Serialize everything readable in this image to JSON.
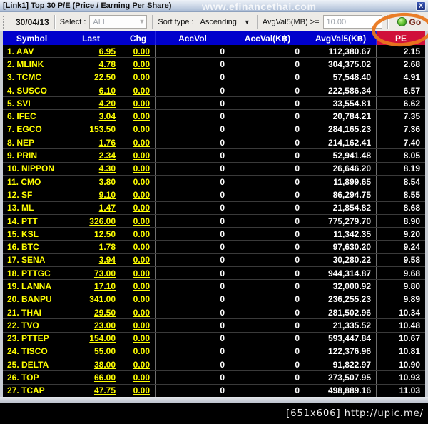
{
  "window": {
    "title": "[Link1] Top 30 P/E (Price / Earning Per Share)",
    "watermark": "www.efinancethai.com",
    "close_label": "X"
  },
  "toolbar": {
    "date": "30/04/13",
    "select_label": "Select :",
    "select_value": "ALL",
    "sort_label": "Sort type :",
    "sort_value": "Ascending",
    "filter_label": "AvgVal5(MB) >=",
    "filter_value": "10.00",
    "go_label": "Go"
  },
  "table": {
    "columns": [
      "Symbol",
      "Last",
      "Chg",
      "AccVol",
      "AccVal(K฿)",
      "AvgVal5(K฿)",
      "PE"
    ],
    "rows": [
      {
        "symbol": "1. AAV",
        "last": "6.95",
        "chg": "0.00",
        "accvol": "0",
        "accval": "0",
        "avgval5": "112,380.67",
        "pe": "2.15"
      },
      {
        "symbol": "2. MLINK",
        "last": "4.78",
        "chg": "0.00",
        "accvol": "0",
        "accval": "0",
        "avgval5": "304,375.02",
        "pe": "2.68"
      },
      {
        "symbol": "3. TCMC",
        "last": "22.50",
        "chg": "0.00",
        "accvol": "0",
        "accval": "0",
        "avgval5": "57,548.40",
        "pe": "4.91"
      },
      {
        "symbol": "4. SUSCO",
        "last": "6.10",
        "chg": "0.00",
        "accvol": "0",
        "accval": "0",
        "avgval5": "222,586.34",
        "pe": "6.57"
      },
      {
        "symbol": "5. SVI",
        "last": "4.20",
        "chg": "0.00",
        "accvol": "0",
        "accval": "0",
        "avgval5": "33,554.81",
        "pe": "6.62"
      },
      {
        "symbol": "6. IFEC",
        "last": "3.04",
        "chg": "0.00",
        "accvol": "0",
        "accval": "0",
        "avgval5": "20,784.21",
        "pe": "7.35"
      },
      {
        "symbol": "7. EGCO",
        "last": "153.50",
        "chg": "0.00",
        "accvol": "0",
        "accval": "0",
        "avgval5": "284,165.23",
        "pe": "7.36"
      },
      {
        "symbol": "8. NEP",
        "last": "1.76",
        "chg": "0.00",
        "accvol": "0",
        "accval": "0",
        "avgval5": "214,162.41",
        "pe": "7.40"
      },
      {
        "symbol": "9. PRIN",
        "last": "2.34",
        "chg": "0.00",
        "accvol": "0",
        "accval": "0",
        "avgval5": "52,941.48",
        "pe": "8.05"
      },
      {
        "symbol": "10. NIPPON",
        "last": "4.30",
        "chg": "0.00",
        "accvol": "0",
        "accval": "0",
        "avgval5": "26,646.20",
        "pe": "8.19"
      },
      {
        "symbol": "11. CMO",
        "last": "3.80",
        "chg": "0.00",
        "accvol": "0",
        "accval": "0",
        "avgval5": "11,899.65",
        "pe": "8.54"
      },
      {
        "symbol": "12. SF",
        "last": "9.10",
        "chg": "0.00",
        "accvol": "0",
        "accval": "0",
        "avgval5": "86,294.75",
        "pe": "8.55"
      },
      {
        "symbol": "13. ML",
        "last": "1.47",
        "chg": "0.00",
        "accvol": "0",
        "accval": "0",
        "avgval5": "21,854.82",
        "pe": "8.68"
      },
      {
        "symbol": "14. PTT",
        "last": "326.00",
        "chg": "0.00",
        "accvol": "0",
        "accval": "0",
        "avgval5": "775,279.70",
        "pe": "8.90"
      },
      {
        "symbol": "15. KSL",
        "last": "12.50",
        "chg": "0.00",
        "accvol": "0",
        "accval": "0",
        "avgval5": "11,342.35",
        "pe": "9.20"
      },
      {
        "symbol": "16. BTC",
        "last": "1.78",
        "chg": "0.00",
        "accvol": "0",
        "accval": "0",
        "avgval5": "97,630.20",
        "pe": "9.24"
      },
      {
        "symbol": "17. SENA",
        "last": "3.94",
        "chg": "0.00",
        "accvol": "0",
        "accval": "0",
        "avgval5": "30,280.22",
        "pe": "9.58"
      },
      {
        "symbol": "18. PTTGC",
        "last": "73.00",
        "chg": "0.00",
        "accvol": "0",
        "accval": "0",
        "avgval5": "944,314.87",
        "pe": "9.68"
      },
      {
        "symbol": "19. LANNA",
        "last": "17.10",
        "chg": "0.00",
        "accvol": "0",
        "accval": "0",
        "avgval5": "32,000.92",
        "pe": "9.80"
      },
      {
        "symbol": "20. BANPU",
        "last": "341.00",
        "chg": "0.00",
        "accvol": "0",
        "accval": "0",
        "avgval5": "236,255.23",
        "pe": "9.89"
      },
      {
        "symbol": "21. THAI",
        "last": "29.50",
        "chg": "0.00",
        "accvol": "0",
        "accval": "0",
        "avgval5": "281,502.96",
        "pe": "10.34"
      },
      {
        "symbol": "22. TVO",
        "last": "23.00",
        "chg": "0.00",
        "accvol": "0",
        "accval": "0",
        "avgval5": "21,335.52",
        "pe": "10.48"
      },
      {
        "symbol": "23. PTTEP",
        "last": "154.00",
        "chg": "0.00",
        "accvol": "0",
        "accval": "0",
        "avgval5": "593,447.84",
        "pe": "10.67"
      },
      {
        "symbol": "24. TISCO",
        "last": "55.00",
        "chg": "0.00",
        "accvol": "0",
        "accval": "0",
        "avgval5": "122,376.96",
        "pe": "10.81"
      },
      {
        "symbol": "25. DELTA",
        "last": "38.00",
        "chg": "0.00",
        "accvol": "0",
        "accval": "0",
        "avgval5": "91,822.97",
        "pe": "10.90"
      },
      {
        "symbol": "26. TOP",
        "last": "66.00",
        "chg": "0.00",
        "accvol": "0",
        "accval": "0",
        "avgval5": "273,507.95",
        "pe": "10.93"
      },
      {
        "symbol": "27. TCAP",
        "last": "47.75",
        "chg": "0.00",
        "accvol": "0",
        "accval": "0",
        "avgval5": "498,889.16",
        "pe": "11.03"
      }
    ]
  },
  "annotation": {
    "shape": "ellipse",
    "color": "#E9771D",
    "target": "PE column header and Go button"
  },
  "caption": "[651x606] http://upic.me/",
  "colors": {
    "header_background": "#0000CC",
    "pe_header_background": "#D0103A",
    "symbol_text": "#FFFF00",
    "value_text": "#FFFFFF",
    "table_background": "#000000"
  }
}
